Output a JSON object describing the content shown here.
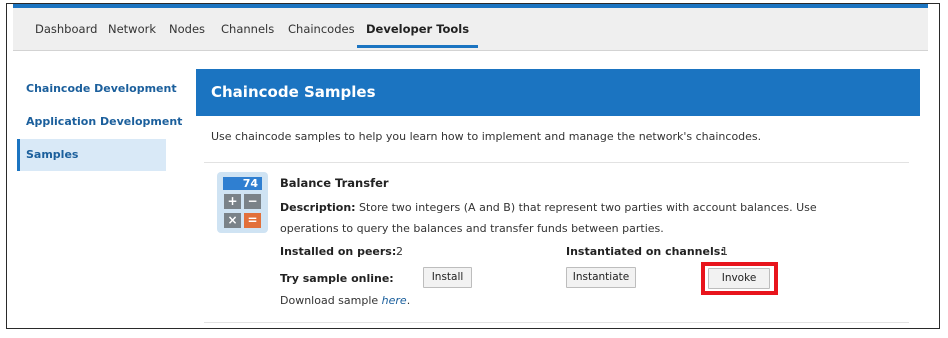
{
  "tabs": [
    {
      "label": "Dashboard"
    },
    {
      "label": "Network"
    },
    {
      "label": "Nodes"
    },
    {
      "label": "Channels"
    },
    {
      "label": "Chaincodes"
    },
    {
      "label": "Developer Tools",
      "active": true
    }
  ],
  "sidebar": {
    "items": [
      {
        "label": "Chaincode Development"
      },
      {
        "label": "Application Development"
      },
      {
        "label": "Samples",
        "active": true
      }
    ]
  },
  "panel": {
    "title": "Chaincode Samples",
    "intro": "Use chaincode samples to help you learn how to implement and manage the network's chaincodes."
  },
  "sample": {
    "icon": {
      "name": "calculator-icon",
      "display": "74",
      "keys": [
        "+",
        "−",
        "×",
        "="
      ]
    },
    "title": "Balance Transfer",
    "description_label": "Description:",
    "description": "Store two integers (A and B) that represent two parties with account balances. Use operations to query the balances and transfer funds between parties.",
    "installed_label": "Installed on peers:",
    "installed_value": "2",
    "instantiated_label": "Instantiated on channels:",
    "instantiated_value": "1",
    "try_label": "Try sample online:",
    "install_button": "Install",
    "instantiate_button": "Instantiate",
    "invoke_button": "Invoke",
    "download_prefix": "Download sample",
    "download_link": "here",
    "download_suffix": "."
  },
  "colors": {
    "accent": "#1b74c1",
    "highlight": "#e8141c",
    "link": "#1b5f9c"
  }
}
